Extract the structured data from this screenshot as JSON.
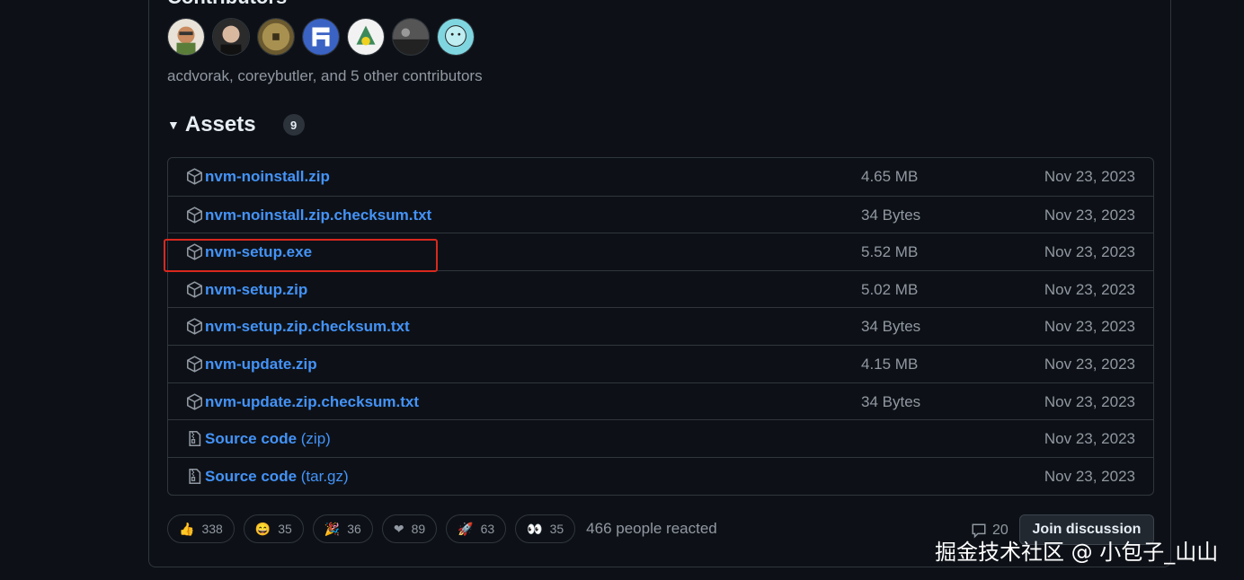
{
  "contributors": {
    "title": "Contributors",
    "summary": "acdvorak, coreybutler, and 5 other contributors",
    "avatars": [
      "avatar-1",
      "avatar-2",
      "avatar-3",
      "avatar-4",
      "avatar-5",
      "avatar-6",
      "avatar-7"
    ]
  },
  "assets": {
    "title": "Assets",
    "count": "9",
    "rows": [
      {
        "name": "nvm-noinstall.zip",
        "suffix": "",
        "size": "4.65 MB",
        "date": "Nov 23, 2023",
        "icon": "package-icon"
      },
      {
        "name": "nvm-noinstall.zip.checksum.txt",
        "suffix": "",
        "size": "34 Bytes",
        "date": "Nov 23, 2023",
        "icon": "package-icon"
      },
      {
        "name": "nvm-setup.exe",
        "suffix": "",
        "size": "5.52 MB",
        "date": "Nov 23, 2023",
        "icon": "package-icon"
      },
      {
        "name": "nvm-setup.zip",
        "suffix": "",
        "size": "5.02 MB",
        "date": "Nov 23, 2023",
        "icon": "package-icon"
      },
      {
        "name": "nvm-setup.zip.checksum.txt",
        "suffix": "",
        "size": "34 Bytes",
        "date": "Nov 23, 2023",
        "icon": "package-icon"
      },
      {
        "name": "nvm-update.zip",
        "suffix": "",
        "size": "4.15 MB",
        "date": "Nov 23, 2023",
        "icon": "package-icon"
      },
      {
        "name": "nvm-update.zip.checksum.txt",
        "suffix": "",
        "size": "34 Bytes",
        "date": "Nov 23, 2023",
        "icon": "package-icon"
      },
      {
        "name": "Source code",
        "suffix": " (zip)",
        "size": "",
        "date": "Nov 23, 2023",
        "icon": "file-zip-icon"
      },
      {
        "name": "Source code",
        "suffix": " (tar.gz)",
        "size": "",
        "date": "Nov 23, 2023",
        "icon": "file-zip-icon"
      }
    ]
  },
  "reactions": {
    "items": [
      {
        "emoji": "👍",
        "count": "338",
        "name": "thumbs-up"
      },
      {
        "emoji": "😄",
        "count": "35",
        "name": "laugh"
      },
      {
        "emoji": "🎉",
        "count": "36",
        "name": "hooray"
      },
      {
        "emoji": "❤",
        "count": "89",
        "name": "heart"
      },
      {
        "emoji": "🚀",
        "count": "63",
        "name": "rocket"
      },
      {
        "emoji": "👀",
        "count": "35",
        "name": "eyes"
      }
    ],
    "summary": "466 people reacted"
  },
  "discussion": {
    "comment_count": "20",
    "join_label": "Join discussion"
  },
  "watermark": "掘金技术社区 @ 小包子_山山",
  "colors": {
    "background": "#0d1117",
    "link": "#4493f8",
    "muted": "#9198a1",
    "border": "#30363d",
    "highlight": "#d9281e"
  }
}
